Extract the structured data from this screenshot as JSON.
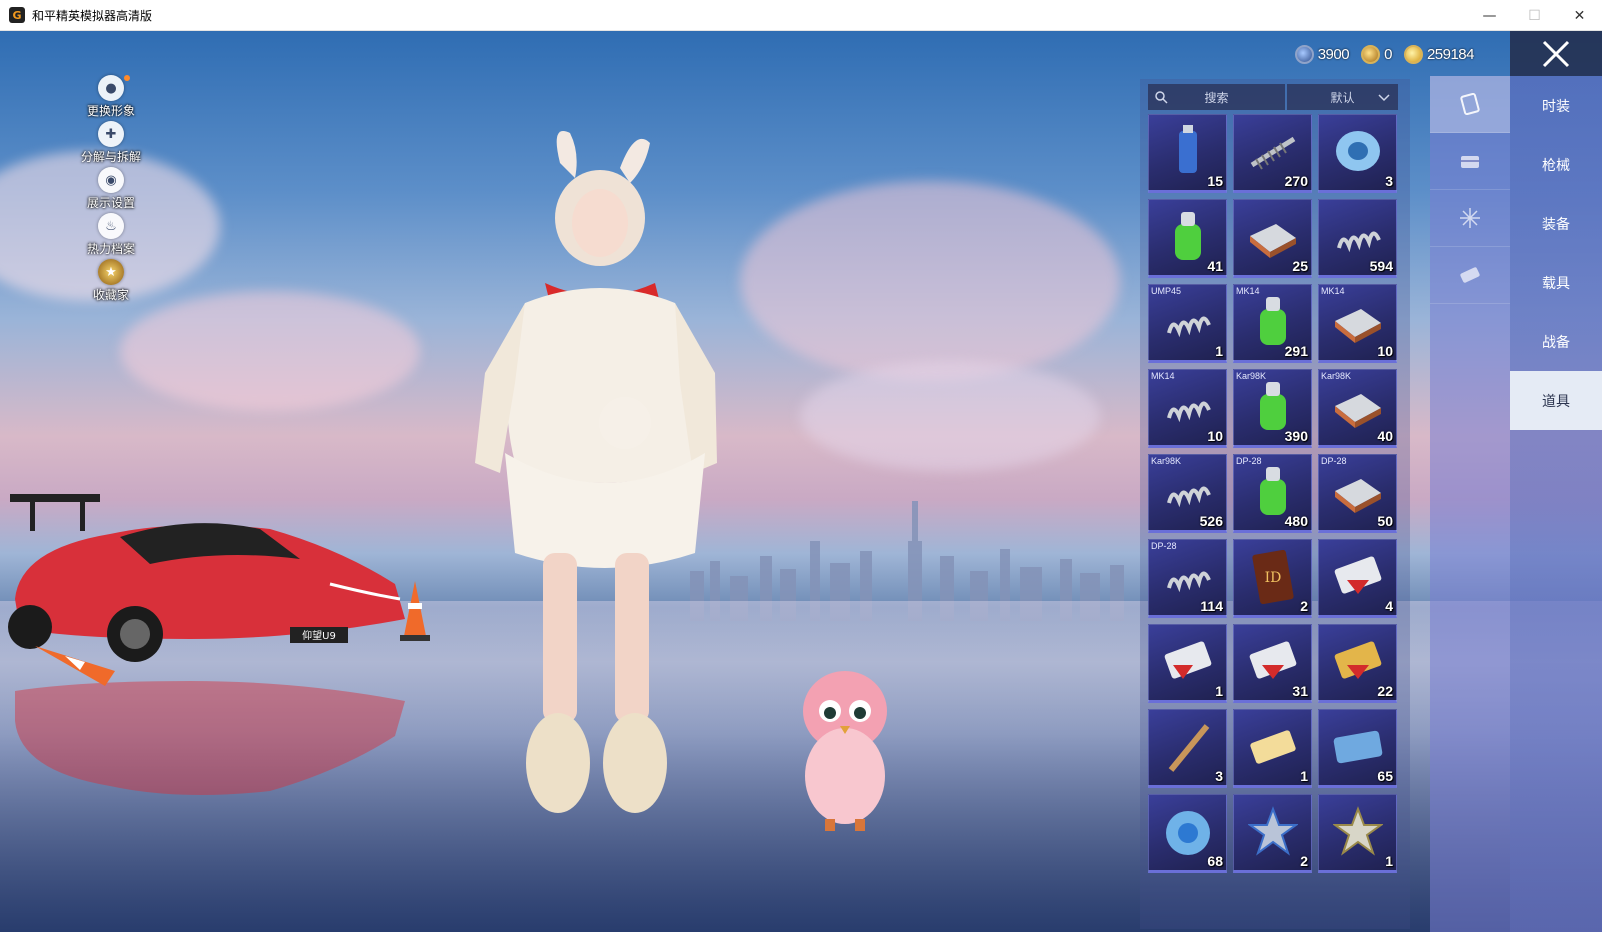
{
  "window": {
    "title": "和平精英模拟器高清版",
    "app_icon_glyph": "G",
    "minimize": "—",
    "maximize": "☐",
    "close": "✕"
  },
  "side_menu": [
    {
      "label": "更换形象",
      "icon": "avatar-icon",
      "notification": true
    },
    {
      "label": "分解与拆解",
      "icon": "puzzle-icon",
      "notification": false
    },
    {
      "label": "展示设置",
      "icon": "eye-icon",
      "notification": false
    },
    {
      "label": "热力档案",
      "icon": "flame-icon",
      "notification": false
    },
    {
      "label": "收藏家",
      "icon": "collector-badge-icon",
      "notification": false
    }
  ],
  "currency": [
    {
      "name": "silver-coin",
      "value": "3900"
    },
    {
      "name": "gold-badge-coin",
      "value": "0"
    },
    {
      "name": "gold-coin",
      "value": "259184"
    }
  ],
  "categories": [
    {
      "label": "时装",
      "active": false
    },
    {
      "label": "枪械",
      "active": false
    },
    {
      "label": "装备",
      "active": false
    },
    {
      "label": "载具",
      "active": false
    },
    {
      "label": "战备",
      "active": false
    },
    {
      "label": "道具",
      "active": true
    }
  ],
  "sub_tabs": [
    {
      "icon": "card-icon",
      "active": true
    },
    {
      "icon": "chest-icon",
      "active": false
    },
    {
      "icon": "firework-icon",
      "active": false
    },
    {
      "icon": "ticket-icon",
      "active": false
    }
  ],
  "inventory": {
    "search_placeholder": "搜索",
    "sort_label": "默认",
    "items": [
      {
        "tag": "",
        "count": "15",
        "art": "spray-can"
      },
      {
        "tag": "",
        "count": "270",
        "art": "spring-bolt"
      },
      {
        "tag": "",
        "count": "3",
        "art": "disc"
      },
      {
        "tag": "",
        "count": "41",
        "art": "green-canister"
      },
      {
        "tag": "",
        "count": "25",
        "art": "tray"
      },
      {
        "tag": "",
        "count": "594",
        "art": "spring"
      },
      {
        "tag": "UMP45",
        "count": "1",
        "art": "spring"
      },
      {
        "tag": "MK14",
        "count": "291",
        "art": "green-canister"
      },
      {
        "tag": "MK14",
        "count": "10",
        "art": "tray"
      },
      {
        "tag": "MK14",
        "count": "10",
        "art": "spring"
      },
      {
        "tag": "Kar98K",
        "count": "390",
        "art": "green-canister"
      },
      {
        "tag": "Kar98K",
        "count": "40",
        "art": "tray"
      },
      {
        "tag": "Kar98K",
        "count": "526",
        "art": "spring"
      },
      {
        "tag": "DP-28",
        "count": "480",
        "art": "green-canister"
      },
      {
        "tag": "DP-28",
        "count": "50",
        "art": "tray"
      },
      {
        "tag": "DP-28",
        "count": "114",
        "art": "spring"
      },
      {
        "tag": "",
        "count": "2",
        "art": "id-card"
      },
      {
        "tag": "",
        "count": "4",
        "art": "exp-card-3d"
      },
      {
        "tag": "",
        "count": "1",
        "art": "exp-card-7d"
      },
      {
        "tag": "",
        "count": "31",
        "art": "exp-card-2h"
      },
      {
        "tag": "",
        "count": "22",
        "art": "gold-card-2h"
      },
      {
        "tag": "",
        "count": "3",
        "art": "stick"
      },
      {
        "tag": "",
        "count": "1",
        "art": "ticket"
      },
      {
        "tag": "",
        "count": "65",
        "art": "initial-ticket"
      },
      {
        "tag": "",
        "count": "68",
        "art": "puzzle-orb"
      },
      {
        "tag": "",
        "count": "2",
        "art": "star-badge-blue"
      },
      {
        "tag": "",
        "count": "1",
        "art": "star-badge-gold"
      }
    ]
  },
  "scene": {
    "car_plate": "仰望U9"
  }
}
